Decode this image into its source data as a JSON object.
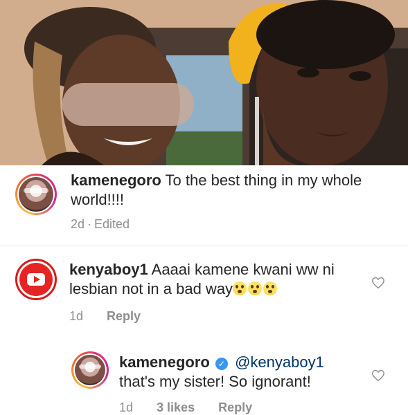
{
  "post": {
    "caption": {
      "username": "kamenegoro",
      "text": "To the best thing in my whole world!!!!",
      "age": "2d",
      "separator": "·",
      "edited": "Edited"
    }
  },
  "comments": [
    {
      "username": "kenyaboy1",
      "text_line1": "Aaaai kamene kwani ww ni",
      "text_line2": "lesbian not in a bad way",
      "emojis": [
        "astonished-face",
        "astonished-face",
        "astonished-face"
      ],
      "age": "1d",
      "reply_label": "Reply",
      "avatar_icon": "youtube-play-icon"
    }
  ],
  "replies": [
    {
      "username": "kamenegoro",
      "verified": true,
      "mention": "@kenyaboy1",
      "text": "that's my sister! So ignorant!",
      "age": "1d",
      "likes": "3 likes",
      "reply_label": "Reply"
    }
  ],
  "colors": {
    "text": "#262626",
    "meta": "#8e8e8e",
    "mention": "#003569",
    "verified": "#3897f0",
    "youtube_red": "#e52524"
  },
  "icons": {
    "like": "heart-outline-icon",
    "verified": "verified-badge-icon"
  }
}
